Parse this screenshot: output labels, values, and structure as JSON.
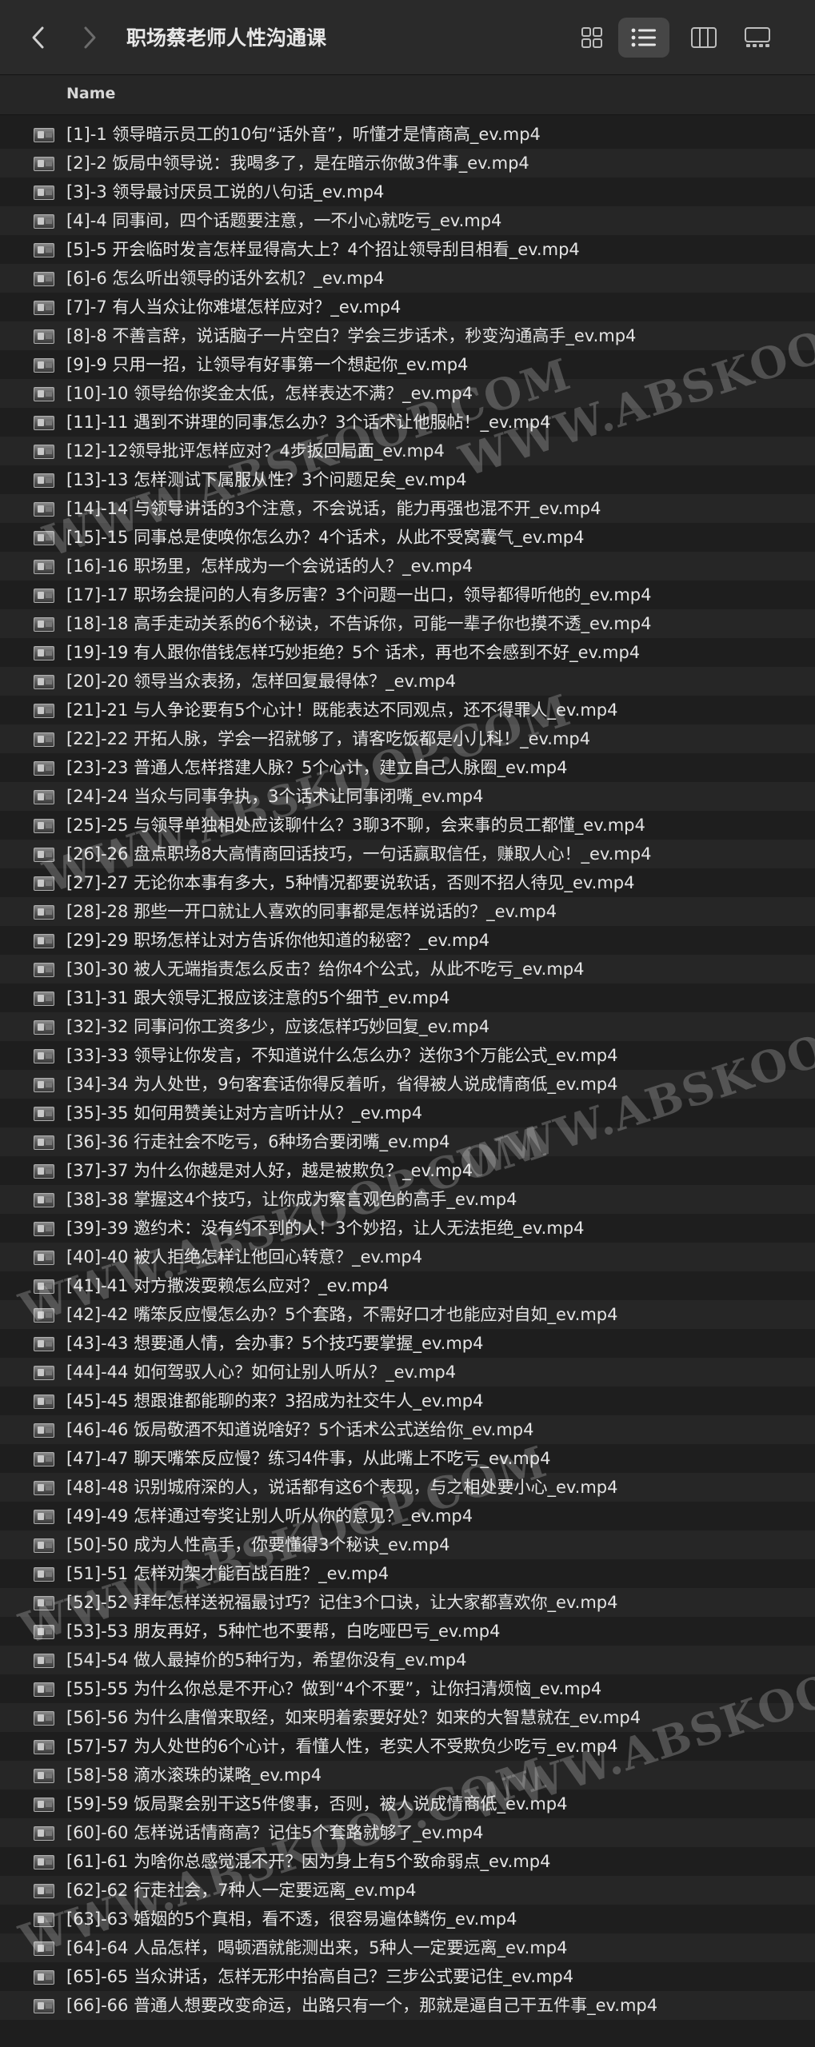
{
  "window": {
    "title": "职场蔡老师人性沟通课"
  },
  "columns": {
    "name": "Name"
  },
  "watermark": "WWW.ABSKOOP.COM",
  "files": [
    "[1]-1 领导暗示员工的10句“话外音”，听懂才是情商高_ev.mp4",
    "[2]-2 饭局中领导说：我喝多了，是在暗示你做3件事_ev.mp4",
    "[3]-3 领导最讨厌员工说的八句话_ev.mp4",
    "[4]-4 同事间，四个话题要注意，一不小心就吃亏_ev.mp4",
    "[5]-5 开会临时发言怎样显得高大上？4个招让领导刮目相看_ev.mp4",
    "[6]-6 怎么听出领导的话外玄机？_ev.mp4",
    "[7]-7 有人当众让你难堪怎样应对？_ev.mp4",
    "[8]-8 不善言辞，说话脑子一片空白？学会三步话术，秒变沟通高手_ev.mp4",
    "[9]-9 只用一招，让领导有好事第一个想起你_ev.mp4",
    "[10]-10 领导给你奖金太低，怎样表达不满？_ev.mp4",
    "[11]-11 遇到不讲理的同事怎么办？3个话术让他服帖！_ev.mp4",
    "[12]-12领导批评怎样应对？4步扳回局面_ev.mp4",
    "[13]-13 怎样测试下属服从性？3个问题足矣_ev.mp4",
    "[14]-14 与领导讲话的3个注意，不会说话，能力再强也混不开_ev.mp4",
    "[15]-15 同事总是使唤你怎么办？4个话术，从此不受窝囊气_ev.mp4",
    "[16]-16 职场里，怎样成为一个会说话的人？_ev.mp4",
    "[17]-17 职场会提问的人有多厉害？3个问题一出口，领导都得听他的_ev.mp4",
    "[18]-18 高手走动关系的6个秘诀，不告诉你，可能一辈子你也摸不透_ev.mp4",
    "[19]-19 有人跟你借钱怎样巧妙拒绝？5个 话术，再也不会感到不好_ev.mp4",
    "[20]-20 领导当众表扬，怎样回复最得体？_ev.mp4",
    "[21]-21 与人争论要有5个心计！既能表达不同观点，还不得罪人_ev.mp4",
    "[22]-22 开拓人脉，学会一招就够了，请客吃饭都是小儿科！_ev.mp4",
    "[23]-23 普通人怎样搭建人脉？5个心计，建立自己人脉圈_ev.mp4",
    "[24]-24 当众与同事争执，3个话术让同事闭嘴_ev.mp4",
    "[25]-25 与领导单独相处应该聊什么？3聊3不聊，会来事的员工都懂_ev.mp4",
    "[26]-26 盘点职场8大高情商回话技巧，一句话赢取信任，赚取人心！_ev.mp4",
    "[27]-27 无论你本事有多大，5种情况都要说软话，否则不招人待见_ev.mp4",
    "[28]-28 那些一开口就让人喜欢的同事都是怎样说话的？_ev.mp4",
    "[29]-29 职场怎样让对方告诉你他知道的秘密？_ev.mp4",
    "[30]-30 被人无端指责怎么反击？给你4个公式，从此不吃亏_ev.mp4",
    "[31]-31 跟大领导汇报应该注意的5个细节_ev.mp4",
    "[32]-32 同事问你工资多少，应该怎样巧妙回复_ev.mp4",
    "[33]-33 领导让你发言，不知道说什么怎么办？送你3个万能公式_ev.mp4",
    "[34]-34 为人处世，9句客套话你得反着听，省得被人说成情商低_ev.mp4",
    "[35]-35 如何用赞美让对方言听计从？_ev.mp4",
    "[36]-36 行走社会不吃亏，6种场合要闭嘴_ev.mp4",
    "[37]-37 为什么你越是对人好，越是被欺负？_ev.mp4",
    "[38]-38 掌握这4个技巧，让你成为察言观色的高手_ev.mp4",
    "[39]-39 邀约术：没有约不到的人！3个妙招，让人无法拒绝_ev.mp4",
    "[40]-40 被人拒绝怎样让他回心转意？_ev.mp4",
    "[41]-41 对方撒泼耍赖怎么应对？_ev.mp4",
    "[42]-42 嘴笨反应慢怎么办？5个套路，不需好口才也能应对自如_ev.mp4",
    "[43]-43 想要通人情，会办事？5个技巧要掌握_ev.mp4",
    "[44]-44 如何驾驭人心？如何让别人听从？_ev.mp4",
    "[45]-45 想跟谁都能聊的来？3招成为社交牛人_ev.mp4",
    "[46]-46 饭局敬酒不知道说啥好？5个话术公式送给你_ev.mp4",
    "[47]-47 聊天嘴笨反应慢？练习4件事，从此嘴上不吃亏_ev.mp4",
    "[48]-48 识别城府深的人，说话都有这6个表现，与之相处要小心_ev.mp4",
    "[49]-49 怎样通过夸奖让别人听从你的意见？_ev.mp4",
    "[50]-50 成为人性高手，你要懂得3个秘诀_ev.mp4",
    "[51]-51 怎样劝架才能百战百胜？_ev.mp4",
    "[52]-52 拜年怎样送祝福最讨巧？记住3个口诀，让大家都喜欢你_ev.mp4",
    "[53]-53 朋友再好，5种忙也不要帮，白吃哑巴亏_ev.mp4",
    "[54]-54 做人最掉价的5种行为，希望你没有_ev.mp4",
    "[55]-55 为什么你总是不开心？做到“4个不要”，让你扫清烦恼_ev.mp4",
    "[56]-56 为什么唐僧来取经，如来明着索要好处？如来的大智慧就在_ev.mp4",
    "[57]-57 为人处世的6个心计，看懂人性，老实人不受欺负少吃亏_ev.mp4",
    "[58]-58 滴水滚珠的谋略_ev.mp4",
    "[59]-59 饭局聚会别干这5件傻事，否则，被人说成情商低_ev.mp4",
    "[60]-60 怎样说话情商高？记住5个套路就够了_ev.mp4",
    "[61]-61 为啥你总感觉混不开？因为身上有5个致命弱点_ev.mp4",
    "[62]-62 行走社会，7种人一定要远离_ev.mp4",
    "[63]-63 婚姻的5个真相，看不透，很容易遍体鳞伤_ev.mp4",
    "[64]-64 人品怎样，喝顿酒就能测出来，5种人一定要远离_ev.mp4",
    "[65]-65 当众讲话，怎样无形中抬高自己？三步公式要记住_ev.mp4",
    "[66]-66 普通人想要改变命运，出路只有一个，那就是逼自己干五件事_ev.mp4"
  ]
}
